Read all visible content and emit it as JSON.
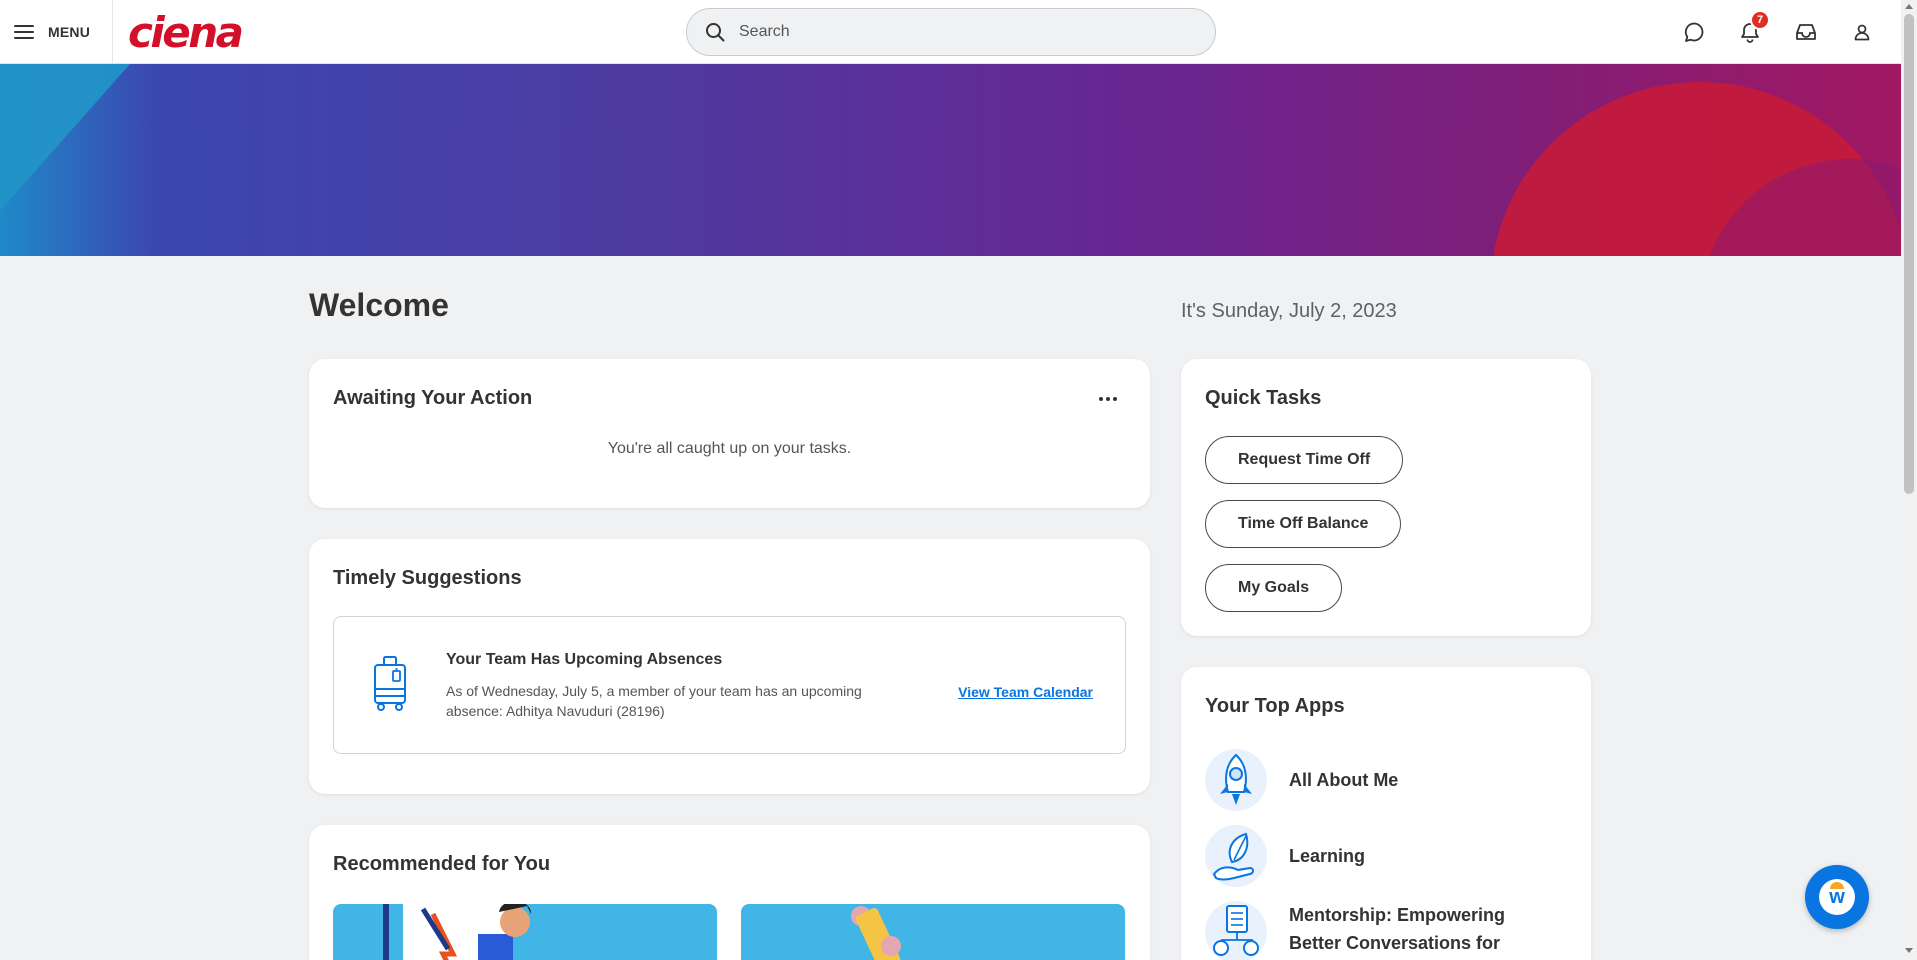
{
  "header": {
    "menu_label": "MENU",
    "logo_text": "ciena",
    "search_placeholder": "Search",
    "notification_count": "7",
    "icons": [
      "menu-icon",
      "chat-icon",
      "bell-icon",
      "inbox-icon",
      "profile-icon",
      "search-icon"
    ]
  },
  "main": {
    "welcome": "Welcome",
    "date": "It's Sunday, July 2, 2023"
  },
  "awaiting": {
    "title": "Awaiting Your Action",
    "message": "You're all caught up on your tasks."
  },
  "timely": {
    "title": "Timely Suggestions",
    "item": {
      "title": "Your Team Has Upcoming Absences",
      "body": "As of Wednesday, July 5, a member of your team has an upcoming absence: Adhitya Navuduri (28196)",
      "link": "View Team Calendar",
      "icon": "luggage-icon"
    }
  },
  "recommended": {
    "title": "Recommended for You"
  },
  "quick_tasks": {
    "title": "Quick Tasks",
    "buttons": [
      "Request Time Off",
      "Time Off Balance",
      "My Goals"
    ]
  },
  "top_apps": {
    "title": "Your Top Apps",
    "apps": [
      {
        "name": "All About Me",
        "icon": "rocket-icon"
      },
      {
        "name": "Learning",
        "icon": "leaf-hand-icon"
      },
      {
        "name": "Mentorship: Empowering Better Conversations for Gro...",
        "icon": "mentorship-icon"
      }
    ]
  },
  "colors": {
    "brand_red": "#d3102a",
    "link_blue": "#0875e1",
    "badge_red": "#de2e21",
    "page_bg": "#f0f1f2"
  }
}
